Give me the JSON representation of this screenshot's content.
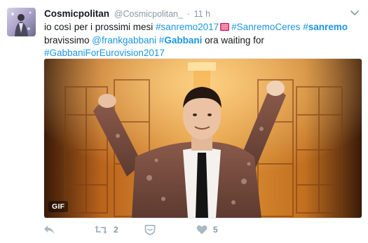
{
  "tweet": {
    "display_name": "Cosmicpolitan",
    "handle": "@Cosmicpolitan_",
    "separator": "·",
    "time": "11 h",
    "text": {
      "l1_a": "io così per i prossimi mesi ",
      "l1_tag1": "#sanremo2017",
      "l1_tag2": "#SanremoCeres",
      "l1_tag3_hash": "#",
      "l1_tag3_word": "sanremo",
      "l2_a": "bravissimo ",
      "l2_mention": "@frankgabbani",
      "l2_tag_hash": "#",
      "l2_tag_word": "Gabbani",
      "l2_b": " ora waiting for",
      "l3_tag": "#GabbaniForEurovision2017"
    },
    "media": {
      "badge": "GIF"
    },
    "actions": {
      "retweet_count": "2",
      "like_count": "5"
    }
  },
  "colors": {
    "link": "#1b95e0",
    "muted": "#8899a6",
    "text": "#14171a"
  },
  "icons": [
    "chevron-down-icon",
    "flag-icon",
    "reply-icon",
    "retweet-icon",
    "shield-icon",
    "heart-icon"
  ]
}
